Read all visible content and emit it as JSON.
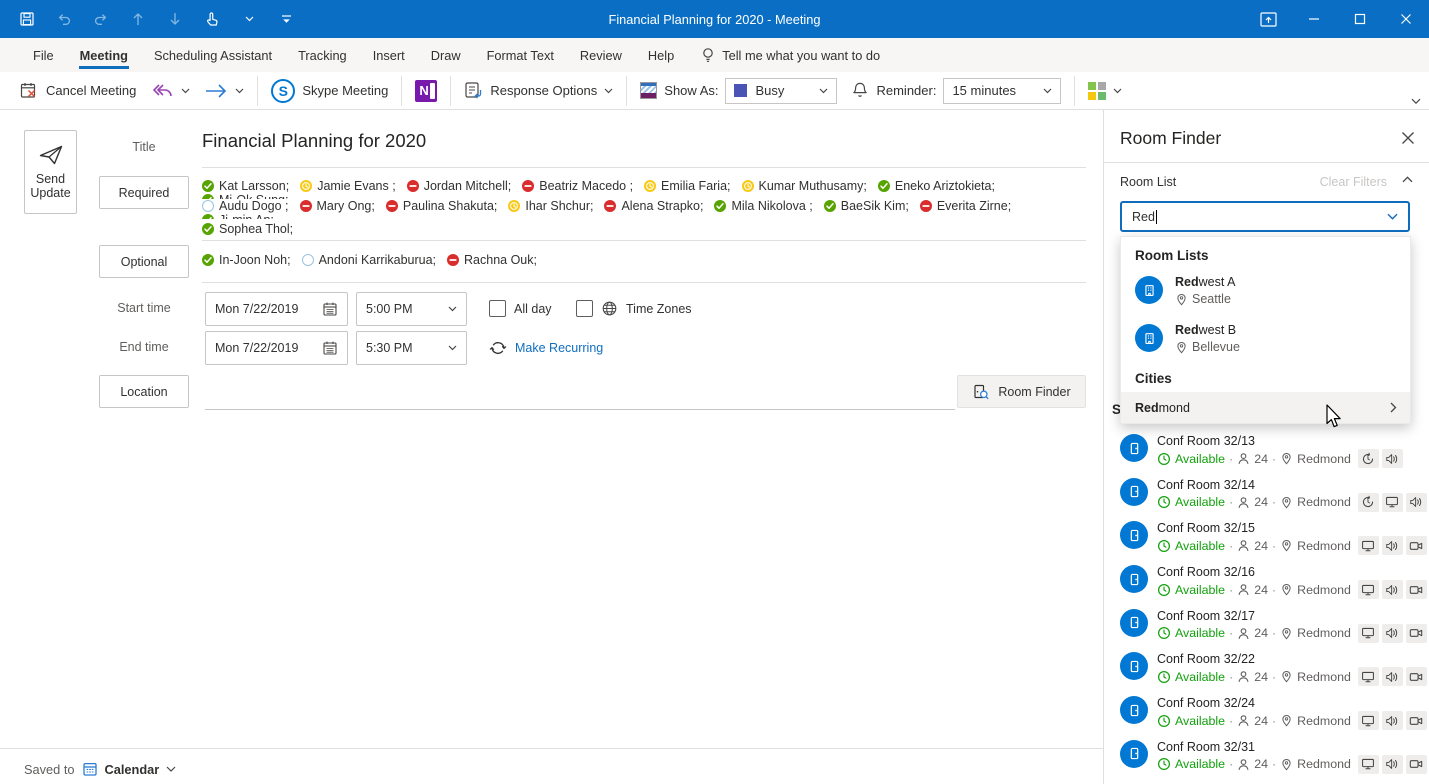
{
  "colors": {
    "titlebar": "#0a6fc4",
    "accent": "#0f6cbd",
    "link": "#106ebe",
    "available": "#13a10e",
    "accepted": "#57a300",
    "tentative": "#f8c916",
    "declined": "#d92c2c",
    "room_blue": "#0078d4",
    "busy": "#4a54b4"
  },
  "titlebar": {
    "title": "Financial Planning for 2020 - Meeting",
    "qat_icons": [
      "save",
      "undo",
      "redo",
      "move-up",
      "move-down",
      "touch-mouse-mode",
      "customize-quick-access-toolbar"
    ],
    "window_icons": [
      "ribbon-display-options",
      "minimize",
      "maximize",
      "close"
    ]
  },
  "menu": {
    "items": [
      {
        "label": "File"
      },
      {
        "label": "Meeting",
        "active": true
      },
      {
        "label": "Scheduling Assistant"
      },
      {
        "label": "Tracking"
      },
      {
        "label": "Insert"
      },
      {
        "label": "Draw"
      },
      {
        "label": "Format Text"
      },
      {
        "label": "Review"
      },
      {
        "label": "Help"
      }
    ],
    "tellme": "Tell me what you want to do"
  },
  "ribbon": {
    "cancel_meeting": "Cancel Meeting",
    "skype_meeting": "Skype Meeting",
    "response_options": "Response Options",
    "show_as_label": "Show As:",
    "show_as_value": "Busy",
    "reminder_label": "Reminder:",
    "reminder_value": "15 minutes"
  },
  "form": {
    "send_update_line1": "Send",
    "send_update_line2": "Update",
    "title_label": "Title",
    "title_value": "Financial Planning for 2020",
    "required_label": "Required",
    "optional_label": "Optional",
    "required_rows": [
      [
        {
          "name": "Kat Larsson;",
          "status": "accepted"
        },
        {
          "name": "Jamie Evans ;",
          "status": "tentative"
        },
        {
          "name": "Jordan Mitchell;",
          "status": "declined"
        },
        {
          "name": "Beatriz Macedo ;",
          "status": "declined"
        },
        {
          "name": "Emilia Faria;",
          "status": "tentative"
        },
        {
          "name": "Kumar Muthusamy;",
          "status": "tentative"
        },
        {
          "name": "Eneko Ariztokieta;",
          "status": "accepted"
        },
        {
          "name": "Mi-Ok Sung;",
          "status": "accepted"
        }
      ],
      [
        {
          "name": "Audu Dogo ;",
          "status": "none"
        },
        {
          "name": "Mary Ong;",
          "status": "declined"
        },
        {
          "name": "Paulina Shakuta;",
          "status": "declined"
        },
        {
          "name": "Ihar Shchur;",
          "status": "tentative"
        },
        {
          "name": "Alena Strapko;",
          "status": "declined"
        },
        {
          "name": "Mila Nikolova ;",
          "status": "accepted"
        },
        {
          "name": "BaeSik Kim;",
          "status": "accepted"
        },
        {
          "name": "Everita Zirne;",
          "status": "declined"
        },
        {
          "name": "Ji-min An;",
          "status": "accepted"
        }
      ],
      [
        {
          "name": "Sophea Thol;",
          "status": "accepted"
        }
      ]
    ],
    "optional_rows": [
      [
        {
          "name": "In-Joon Noh;",
          "status": "accepted"
        },
        {
          "name": "Andoni Karrikaburua;",
          "status": "none"
        },
        {
          "name": "Rachna Ouk;",
          "status": "declined"
        }
      ]
    ],
    "start_label": "Start time",
    "end_label": "End time",
    "start_date": "Mon 7/22/2019",
    "start_time": "5:00 PM",
    "end_date": "Mon 7/22/2019",
    "end_time": "5:30 PM",
    "all_day": "All day",
    "time_zones": "Time Zones",
    "make_recurring": "Make Recurring",
    "location_label": "Location",
    "location_value": "",
    "room_finder_button": "Room Finder"
  },
  "footer": {
    "saved_to": "Saved to",
    "calendar": "Calendar"
  },
  "room_finder": {
    "title": "Room Finder",
    "room_list_label": "Room List",
    "clear_filters": "Clear Filters",
    "search_value": "Red",
    "behind_text": "S",
    "dropdown": {
      "room_lists_heading": "Room Lists",
      "room_lists": [
        {
          "match": "Red",
          "rest": "west A",
          "city": "Seattle"
        },
        {
          "match": "Red",
          "rest": "west B",
          "city": "Bellevue"
        }
      ],
      "cities_heading": "Cities",
      "cities": [
        {
          "match": "Red",
          "rest": "mond"
        }
      ]
    },
    "rooms": [
      {
        "name": "Conf Room 32/13",
        "status": "Available",
        "capacity": "24",
        "city": "Redmond",
        "features": [
          "rotate",
          "audio"
        ]
      },
      {
        "name": "Conf Room 32/14",
        "status": "Available",
        "capacity": "24",
        "city": "Redmond",
        "features": [
          "rotate",
          "display",
          "audio"
        ]
      },
      {
        "name": "Conf Room 32/15",
        "status": "Available",
        "capacity": "24",
        "city": "Redmond",
        "features": [
          "display",
          "audio",
          "camera"
        ]
      },
      {
        "name": "Conf Room 32/16",
        "status": "Available",
        "capacity": "24",
        "city": "Redmond",
        "features": [
          "display",
          "audio",
          "camera"
        ]
      },
      {
        "name": "Conf Room 32/17",
        "status": "Available",
        "capacity": "24",
        "city": "Redmond",
        "features": [
          "display",
          "audio",
          "camera"
        ]
      },
      {
        "name": "Conf Room 32/22",
        "status": "Available",
        "capacity": "24",
        "city": "Redmond",
        "features": [
          "display",
          "audio",
          "camera"
        ]
      },
      {
        "name": "Conf Room 32/24",
        "status": "Available",
        "capacity": "24",
        "city": "Redmond",
        "features": [
          "display",
          "audio",
          "camera"
        ]
      },
      {
        "name": "Conf Room 32/31",
        "status": "Available",
        "capacity": "24",
        "city": "Redmond",
        "features": [
          "display",
          "audio",
          "camera"
        ]
      }
    ]
  }
}
